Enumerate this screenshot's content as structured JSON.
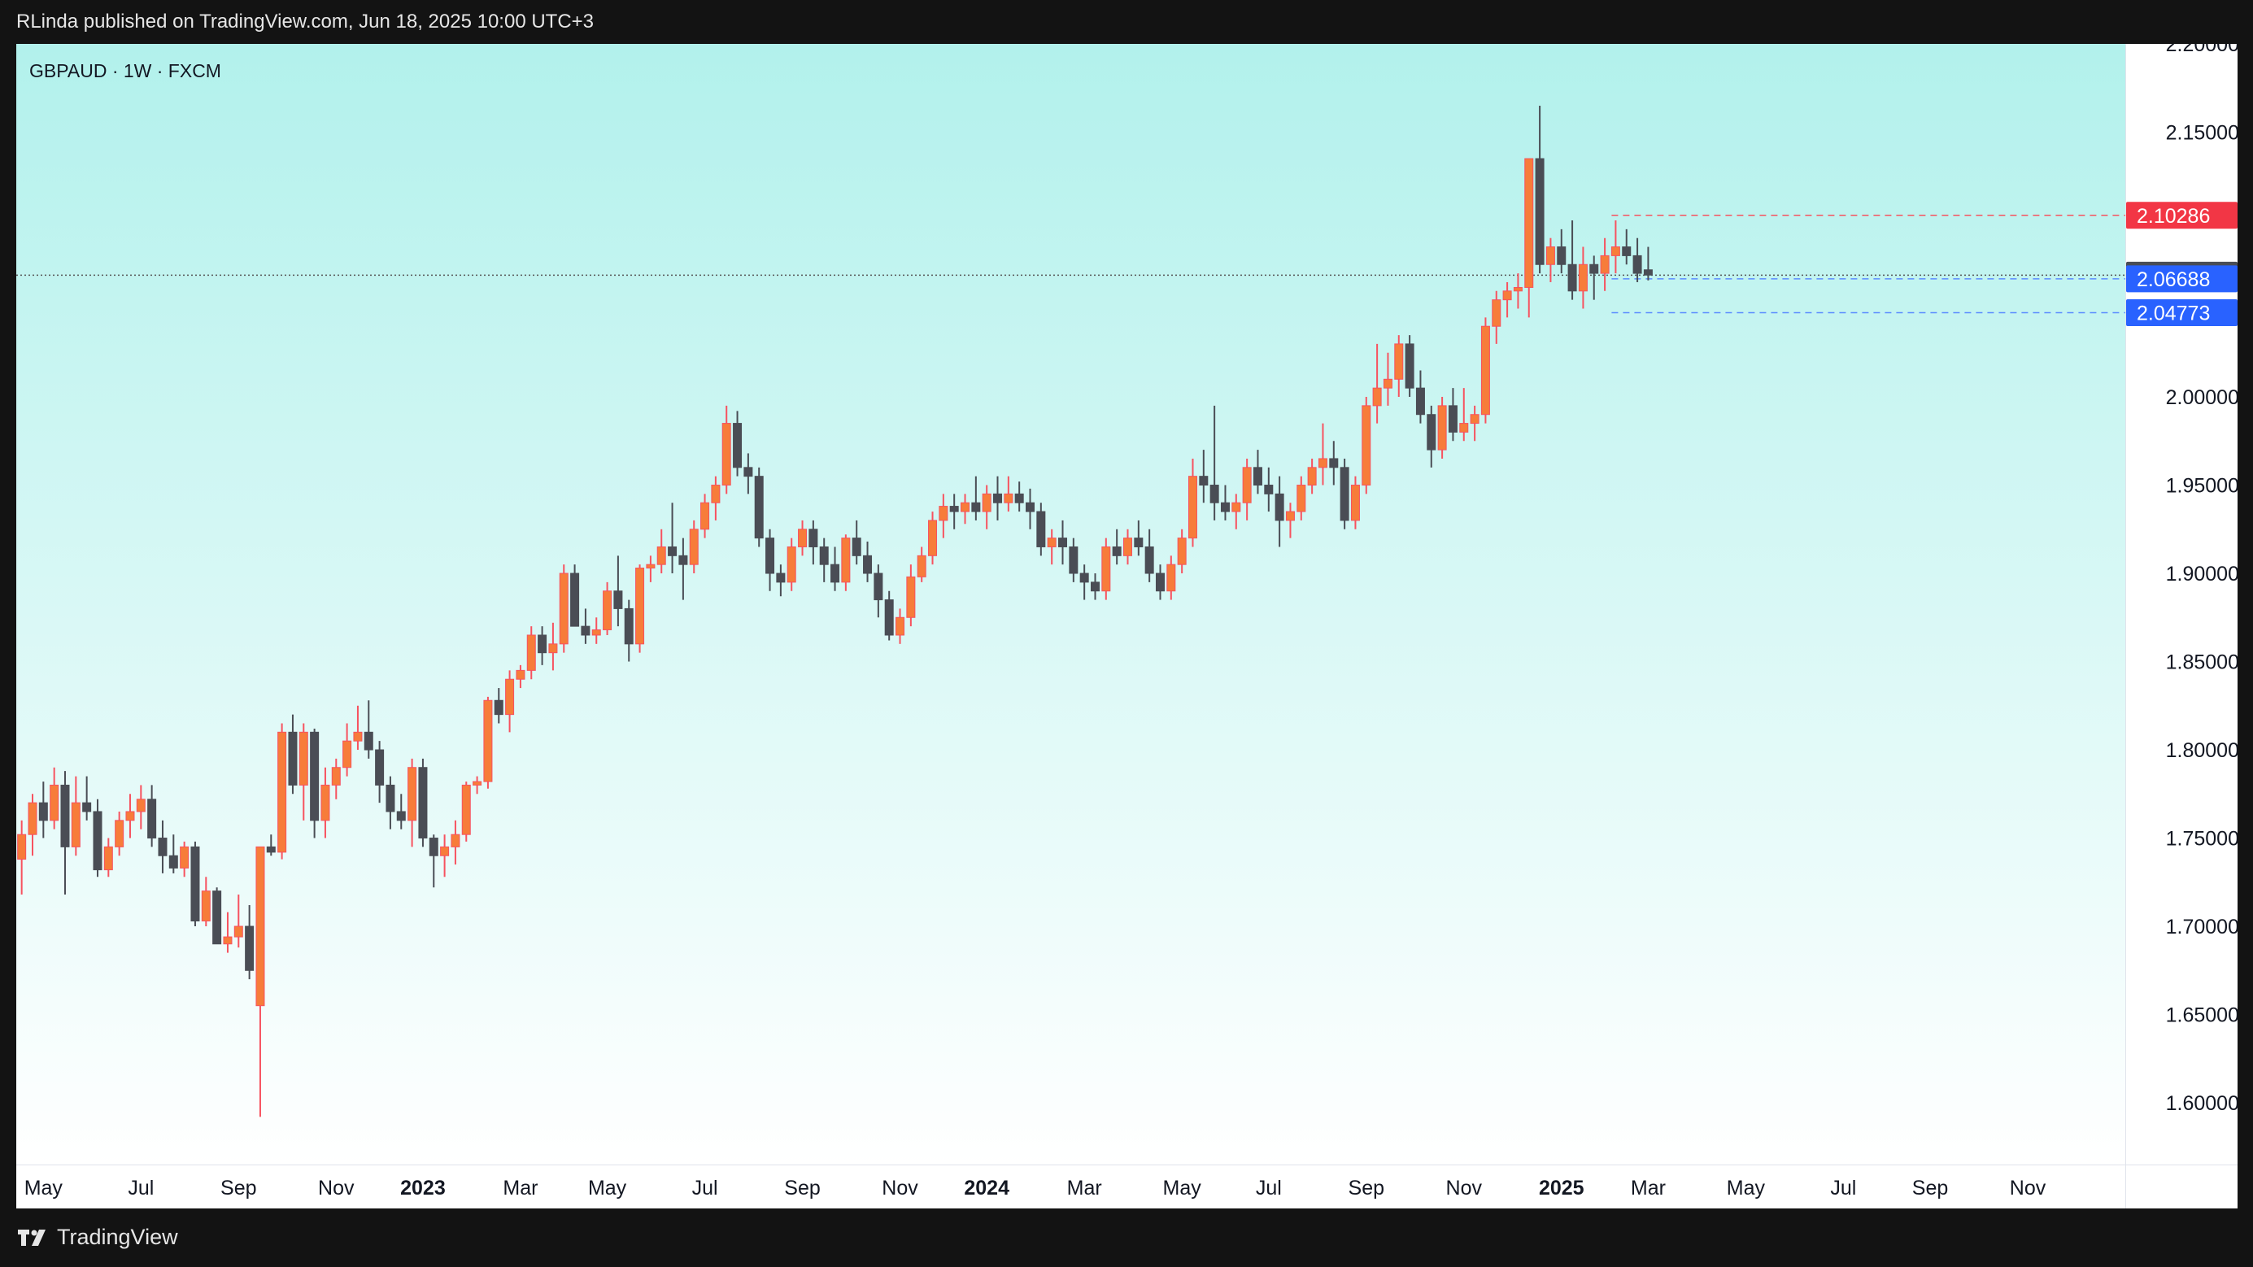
{
  "header": {
    "published_text": "RLinda published on TradingView.com, Jun 18, 2025 10:00 UTC+3"
  },
  "footer": {
    "brand": "TradingView",
    "logo_icon": "tradingview-logo-icon"
  },
  "chart_data": {
    "type": "candlestick",
    "symbol_label": "GBPAUD · 1W · FXCM",
    "timeframe": "1W",
    "y_axis": {
      "ylim": [
        1.565,
        2.2
      ],
      "ticks": [
        "1.60000",
        "1.65000",
        "1.70000",
        "1.75000",
        "1.80000",
        "1.85000",
        "1.90000",
        "1.95000",
        "2.00000",
        "2.05000",
        "2.10000",
        "2.15000",
        "2.20000"
      ],
      "position": "right"
    },
    "x_axis": {
      "ticks": [
        {
          "label": "May",
          "week": 2,
          "bold": false
        },
        {
          "label": "Jul",
          "week": 11,
          "bold": false
        },
        {
          "label": "Sep",
          "week": 20,
          "bold": false
        },
        {
          "label": "Nov",
          "week": 29,
          "bold": false
        },
        {
          "label": "2023",
          "week": 37,
          "bold": true
        },
        {
          "label": "Mar",
          "week": 46,
          "bold": false
        },
        {
          "label": "May",
          "week": 54,
          "bold": false
        },
        {
          "label": "Jul",
          "week": 63,
          "bold": false
        },
        {
          "label": "Sep",
          "week": 72,
          "bold": false
        },
        {
          "label": "Nov",
          "week": 81,
          "bold": false
        },
        {
          "label": "2024",
          "week": 89,
          "bold": true
        },
        {
          "label": "Mar",
          "week": 98,
          "bold": false
        },
        {
          "label": "May",
          "week": 107,
          "bold": false
        },
        {
          "label": "Jul",
          "week": 115,
          "bold": false
        },
        {
          "label": "Sep",
          "week": 124,
          "bold": false
        },
        {
          "label": "Nov",
          "week": 133,
          "bold": false
        },
        {
          "label": "2025",
          "week": 142,
          "bold": true
        },
        {
          "label": "Mar",
          "week": 150,
          "bold": false
        },
        {
          "label": "May",
          "week": 159,
          "bold": false
        },
        {
          "label": "Jul",
          "week": 168,
          "bold": false
        },
        {
          "label": "Sep",
          "week": 176,
          "bold": false
        },
        {
          "label": "Nov",
          "week": 185,
          "bold": false
        }
      ],
      "week_range": [
        -0.5,
        194
      ]
    },
    "candles": [
      [
        1.738,
        1.76,
        1.718,
        1.752
      ],
      [
        1.752,
        1.775,
        1.74,
        1.77
      ],
      [
        1.77,
        1.782,
        1.75,
        1.76
      ],
      [
        1.76,
        1.79,
        1.755,
        1.78
      ],
      [
        1.78,
        1.788,
        1.718,
        1.745
      ],
      [
        1.745,
        1.785,
        1.74,
        1.77
      ],
      [
        1.77,
        1.785,
        1.76,
        1.765
      ],
      [
        1.765,
        1.772,
        1.728,
        1.732
      ],
      [
        1.732,
        1.75,
        1.728,
        1.745
      ],
      [
        1.745,
        1.765,
        1.74,
        1.76
      ],
      [
        1.76,
        1.775,
        1.75,
        1.765
      ],
      [
        1.765,
        1.78,
        1.755,
        1.772
      ],
      [
        1.772,
        1.78,
        1.745,
        1.75
      ],
      [
        1.75,
        1.76,
        1.73,
        1.74
      ],
      [
        1.74,
        1.752,
        1.73,
        1.733
      ],
      [
        1.733,
        1.748,
        1.728,
        1.745
      ],
      [
        1.745,
        1.748,
        1.7,
        1.703
      ],
      [
        1.703,
        1.728,
        1.7,
        1.72
      ],
      [
        1.72,
        1.722,
        1.69,
        1.69
      ],
      [
        1.69,
        1.708,
        1.685,
        1.694
      ],
      [
        1.694,
        1.718,
        1.688,
        1.7
      ],
      [
        1.7,
        1.712,
        1.67,
        1.675
      ],
      [
        1.655,
        1.745,
        1.592,
        1.745
      ],
      [
        1.745,
        1.752,
        1.74,
        1.742
      ],
      [
        1.742,
        1.815,
        1.738,
        1.81
      ],
      [
        1.81,
        1.82,
        1.775,
        1.78
      ],
      [
        1.78,
        1.815,
        1.76,
        1.81
      ],
      [
        1.81,
        1.812,
        1.75,
        1.76
      ],
      [
        1.76,
        1.79,
        1.75,
        1.78
      ],
      [
        1.78,
        1.795,
        1.772,
        1.79
      ],
      [
        1.79,
        1.815,
        1.785,
        1.805
      ],
      [
        1.805,
        1.825,
        1.8,
        1.81
      ],
      [
        1.81,
        1.828,
        1.795,
        1.8
      ],
      [
        1.8,
        1.805,
        1.77,
        1.78
      ],
      [
        1.78,
        1.785,
        1.755,
        1.765
      ],
      [
        1.765,
        1.775,
        1.755,
        1.76
      ],
      [
        1.76,
        1.795,
        1.745,
        1.79
      ],
      [
        1.79,
        1.795,
        1.745,
        1.75
      ],
      [
        1.75,
        1.752,
        1.722,
        1.74
      ],
      [
        1.74,
        1.752,
        1.728,
        1.745
      ],
      [
        1.745,
        1.76,
        1.735,
        1.752
      ],
      [
        1.752,
        1.782,
        1.748,
        1.78
      ],
      [
        1.78,
        1.785,
        1.775,
        1.782
      ],
      [
        1.782,
        1.83,
        1.778,
        1.828
      ],
      [
        1.828,
        1.835,
        1.815,
        1.82
      ],
      [
        1.82,
        1.845,
        1.81,
        1.84
      ],
      [
        1.84,
        1.848,
        1.835,
        1.845
      ],
      [
        1.845,
        1.87,
        1.84,
        1.865
      ],
      [
        1.865,
        1.87,
        1.848,
        1.855
      ],
      [
        1.855,
        1.872,
        1.845,
        1.86
      ],
      [
        1.86,
        1.905,
        1.855,
        1.9
      ],
      [
        1.9,
        1.905,
        1.87,
        1.87
      ],
      [
        1.87,
        1.88,
        1.86,
        1.865
      ],
      [
        1.865,
        1.875,
        1.86,
        1.868
      ],
      [
        1.868,
        1.895,
        1.865,
        1.89
      ],
      [
        1.89,
        1.91,
        1.87,
        1.88
      ],
      [
        1.88,
        1.885,
        1.85,
        1.86
      ],
      [
        1.86,
        1.905,
        1.855,
        1.903
      ],
      [
        1.903,
        1.91,
        1.895,
        1.905
      ],
      [
        1.905,
        1.925,
        1.9,
        1.915
      ],
      [
        1.915,
        1.94,
        1.9,
        1.91
      ],
      [
        1.91,
        1.92,
        1.885,
        1.905
      ],
      [
        1.905,
        1.93,
        1.9,
        1.925
      ],
      [
        1.925,
        1.945,
        1.92,
        1.94
      ],
      [
        1.94,
        1.955,
        1.93,
        1.95
      ],
      [
        1.95,
        1.995,
        1.945,
        1.985
      ],
      [
        1.985,
        1.992,
        1.955,
        1.96
      ],
      [
        1.96,
        1.968,
        1.945,
        1.955
      ],
      [
        1.955,
        1.96,
        1.915,
        1.92
      ],
      [
        1.92,
        1.925,
        1.89,
        1.9
      ],
      [
        1.9,
        1.905,
        1.887,
        1.895
      ],
      [
        1.895,
        1.92,
        1.89,
        1.915
      ],
      [
        1.915,
        1.93,
        1.91,
        1.925
      ],
      [
        1.925,
        1.93,
        1.905,
        1.915
      ],
      [
        1.915,
        1.92,
        1.895,
        1.905
      ],
      [
        1.905,
        1.915,
        1.89,
        1.895
      ],
      [
        1.895,
        1.922,
        1.89,
        1.92
      ],
      [
        1.92,
        1.93,
        1.905,
        1.91
      ],
      [
        1.91,
        1.918,
        1.895,
        1.9
      ],
      [
        1.9,
        1.905,
        1.875,
        1.885
      ],
      [
        1.885,
        1.89,
        1.862,
        1.865
      ],
      [
        1.865,
        1.88,
        1.86,
        1.875
      ],
      [
        1.875,
        1.905,
        1.87,
        1.898
      ],
      [
        1.898,
        1.915,
        1.895,
        1.91
      ],
      [
        1.91,
        1.935,
        1.905,
        1.93
      ],
      [
        1.93,
        1.945,
        1.92,
        1.938
      ],
      [
        1.938,
        1.945,
        1.925,
        1.935
      ],
      [
        1.935,
        1.945,
        1.928,
        1.94
      ],
      [
        1.94,
        1.955,
        1.93,
        1.935
      ],
      [
        1.935,
        1.95,
        1.925,
        1.945
      ],
      [
        1.945,
        1.955,
        1.93,
        1.94
      ],
      [
        1.94,
        1.955,
        1.935,
        1.945
      ],
      [
        1.945,
        1.952,
        1.935,
        1.94
      ],
      [
        1.94,
        1.948,
        1.925,
        1.935
      ],
      [
        1.935,
        1.94,
        1.91,
        1.915
      ],
      [
        1.915,
        1.925,
        1.905,
        1.92
      ],
      [
        1.92,
        1.93,
        1.905,
        1.915
      ],
      [
        1.915,
        1.92,
        1.895,
        1.9
      ],
      [
        1.9,
        1.905,
        1.885,
        1.895
      ],
      [
        1.895,
        1.9,
        1.885,
        1.89
      ],
      [
        1.89,
        1.92,
        1.885,
        1.915
      ],
      [
        1.915,
        1.925,
        1.905,
        1.91
      ],
      [
        1.91,
        1.925,
        1.905,
        1.92
      ],
      [
        1.92,
        1.93,
        1.91,
        1.915
      ],
      [
        1.915,
        1.925,
        1.895,
        1.9
      ],
      [
        1.9,
        1.905,
        1.885,
        1.89
      ],
      [
        1.89,
        1.91,
        1.885,
        1.905
      ],
      [
        1.905,
        1.925,
        1.9,
        1.92
      ],
      [
        1.92,
        1.965,
        1.915,
        1.955
      ],
      [
        1.955,
        1.97,
        1.94,
        1.95
      ],
      [
        1.95,
        1.995,
        1.93,
        1.94
      ],
      [
        1.94,
        1.95,
        1.93,
        1.935
      ],
      [
        1.935,
        1.945,
        1.925,
        1.94
      ],
      [
        1.94,
        1.965,
        1.93,
        1.96
      ],
      [
        1.96,
        1.97,
        1.945,
        1.95
      ],
      [
        1.95,
        1.96,
        1.935,
        1.945
      ],
      [
        1.945,
        1.955,
        1.915,
        1.93
      ],
      [
        1.93,
        1.94,
        1.92,
        1.935
      ],
      [
        1.935,
        1.955,
        1.93,
        1.95
      ],
      [
        1.95,
        1.965,
        1.945,
        1.96
      ],
      [
        1.96,
        1.985,
        1.95,
        1.965
      ],
      [
        1.965,
        1.975,
        1.95,
        1.96
      ],
      [
        1.96,
        1.965,
        1.925,
        1.93
      ],
      [
        1.93,
        1.955,
        1.925,
        1.95
      ],
      [
        1.95,
        2.0,
        1.945,
        1.995
      ],
      [
        1.995,
        2.03,
        1.985,
        2.005
      ],
      [
        2.005,
        2.025,
        1.995,
        2.01
      ],
      [
        2.01,
        2.035,
        2.0,
        2.03
      ],
      [
        2.03,
        2.035,
        2.0,
        2.005
      ],
      [
        2.005,
        2.015,
        1.985,
        1.99
      ],
      [
        1.99,
        1.995,
        1.96,
        1.97
      ],
      [
        1.97,
        2.0,
        1.965,
        1.995
      ],
      [
        1.995,
        2.005,
        1.975,
        1.98
      ],
      [
        1.98,
        2.005,
        1.975,
        1.985
      ],
      [
        1.985,
        1.995,
        1.975,
        1.99
      ],
      [
        1.99,
        2.045,
        1.985,
        2.04
      ],
      [
        2.04,
        2.06,
        2.03,
        2.055
      ],
      [
        2.055,
        2.065,
        2.045,
        2.06
      ],
      [
        2.06,
        2.07,
        2.05,
        2.062
      ],
      [
        2.062,
        2.135,
        2.045,
        2.135
      ],
      [
        2.135,
        2.165,
        2.07,
        2.075
      ],
      [
        2.075,
        2.09,
        2.065,
        2.085
      ],
      [
        2.085,
        2.095,
        2.07,
        2.075
      ],
      [
        2.075,
        2.1,
        2.055,
        2.06
      ],
      [
        2.06,
        2.085,
        2.05,
        2.075
      ],
      [
        2.075,
        2.08,
        2.055,
        2.07
      ],
      [
        2.07,
        2.09,
        2.06,
        2.08
      ],
      [
        2.08,
        2.1,
        2.07,
        2.085
      ],
      [
        2.085,
        2.095,
        2.075,
        2.08
      ],
      [
        2.08,
        2.09,
        2.065,
        2.07
      ],
      [
        2.072,
        2.085,
        2.066,
        2.069
      ]
    ],
    "colors": {
      "up": "#f7525f",
      "up_body": "#f08a4b",
      "down": "#4a4d55",
      "up_body_fill": "#f77c3a"
    },
    "price_labels": [
      {
        "value": "2.10286",
        "price": 2.10286,
        "bg": "#f23645",
        "color": "#ffffff",
        "line": "dashed",
        "line_color": "#f7525f"
      },
      {
        "value": "2.06898",
        "price": 2.06898,
        "bg": "#4a4d55",
        "color": "#ffffff",
        "line": "dotted",
        "line_color": "#555555"
      },
      {
        "value": "2.06688",
        "price": 2.06688,
        "bg": "#2962ff",
        "color": "#ffffff",
        "line": "dashed",
        "line_color": "#5b8cff"
      },
      {
        "value": "2.04773",
        "price": 2.04773,
        "bg": "#2962ff",
        "color": "#ffffff",
        "line": "dashed",
        "line_color": "#5b8cff"
      }
    ],
    "range_box": {
      "start_week": 147,
      "end_week": 157
    }
  }
}
